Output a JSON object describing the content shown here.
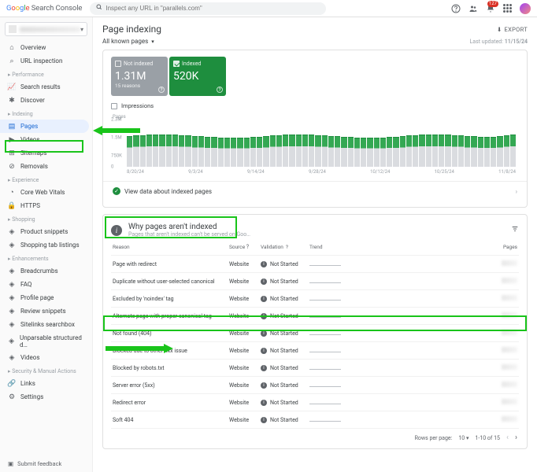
{
  "header": {
    "product": "Search Console",
    "search_placeholder": "Inspect any URL in \"parallels.com\"",
    "badge": "127"
  },
  "sidebar": {
    "overview": "Overview",
    "url_inspection": "URL inspection",
    "perf_group": "Performance",
    "search_results": "Search results",
    "discover": "Discover",
    "idx_group": "Indexing",
    "pages": "Pages",
    "videos": "Videos",
    "sitemaps": "Sitemaps",
    "removals": "Removals",
    "exp_group": "Experience",
    "cwv": "Core Web Vitals",
    "https": "HTTPS",
    "shop_group": "Shopping",
    "product_snippets": "Product snippets",
    "shopping_tab": "Shopping tab listings",
    "enh_group": "Enhancements",
    "breadcrumbs": "Breadcrumbs",
    "faq": "FAQ",
    "profile": "Profile page",
    "review_snippets": "Review snippets",
    "sitelinks": "Sitelinks searchbox",
    "unparsable": "Unparsable structured d…",
    "videos2": "Videos",
    "sec_group": "Security & Manual Actions",
    "links": "Links",
    "settings": "Settings",
    "feedback": "Submit feedback"
  },
  "page": {
    "title": "Page indexing",
    "export": "EXPORT",
    "filter": "All known pages",
    "last_updated_label": "Last updated:",
    "last_updated": "11/15/24"
  },
  "tiles": {
    "not_indexed_label": "Not indexed",
    "not_indexed_value": "1.31M",
    "not_indexed_sub": "15 reasons",
    "indexed_label": "Indexed",
    "indexed_value": "520K"
  },
  "chart_data": {
    "type": "bar",
    "title": "Pages",
    "impressions_label": "Impressions",
    "y_ticks": [
      "2.3M",
      "1.5M",
      "750K",
      "0"
    ],
    "x_ticks": [
      "8/20/24",
      "9/3/24",
      "9/14/24",
      "9/28/24",
      "10/12/24",
      "10/25/24",
      "11/8/24"
    ],
    "bars_total_approx": 2000000,
    "indexed_fraction_approx": 0.35,
    "view_link": "View data about indexed pages"
  },
  "reasons": {
    "title": "Why pages aren't indexed",
    "subtitle": "Pages that aren't indexed can't be served on Goo…",
    "columns": {
      "reason": "Reason",
      "source": "Source",
      "validation": "Validation",
      "trend": "Trend",
      "pages": "Pages"
    },
    "rows": [
      {
        "reason": "Page with redirect",
        "source": "Website",
        "validation": "Not Started"
      },
      {
        "reason": "Duplicate without user-selected canonical",
        "source": "Website",
        "validation": "Not Started"
      },
      {
        "reason": "Excluded by 'noindex' tag",
        "source": "Website",
        "validation": "Not Started"
      },
      {
        "reason": "Alternate page with proper canonical tag",
        "source": "Website",
        "validation": "Not Started"
      },
      {
        "reason": "Not found (404)",
        "source": "Website",
        "validation": "Not Started"
      },
      {
        "reason": "Blocked due to other 4xx issue",
        "source": "Website",
        "validation": "Not Started"
      },
      {
        "reason": "Blocked by robots.txt",
        "source": "Website",
        "validation": "Not Started"
      },
      {
        "reason": "Server error (5xx)",
        "source": "Website",
        "validation": "Not Started"
      },
      {
        "reason": "Redirect error",
        "source": "Website",
        "validation": "Not Started"
      },
      {
        "reason": "Soft 404",
        "source": "Website",
        "validation": "Not Started"
      }
    ],
    "footer": {
      "rpp_label": "Rows per page:",
      "rpp": "10",
      "range": "1-10 of 15"
    }
  }
}
